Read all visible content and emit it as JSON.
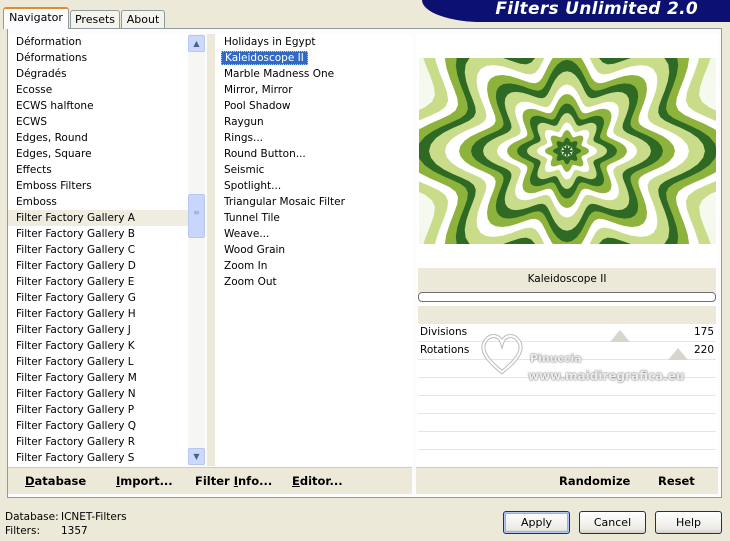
{
  "window": {
    "title": "Filters Unlimited 2.0"
  },
  "tabs": [
    {
      "label": "Navigator",
      "active": true
    },
    {
      "label": "Presets",
      "active": false
    },
    {
      "label": "About",
      "active": false
    }
  ],
  "categories": {
    "items": [
      "Déformation",
      "Déformations",
      "Dégradés",
      "Ecosse",
      "ECWS halftone",
      "ECWS",
      "Edges, Round",
      "Edges, Square",
      "Effects",
      "Emboss Filters",
      "Emboss",
      "Filter Factory Gallery A",
      "Filter Factory Gallery B",
      "Filter Factory Gallery C",
      "Filter Factory Gallery D",
      "Filter Factory Gallery E",
      "Filter Factory Gallery G",
      "Filter Factory Gallery H",
      "Filter Factory Gallery J",
      "Filter Factory Gallery K",
      "Filter Factory Gallery L",
      "Filter Factory Gallery M",
      "Filter Factory Gallery N",
      "Filter Factory Gallery P",
      "Filter Factory Gallery Q",
      "Filter Factory Gallery R",
      "Filter Factory Gallery S"
    ],
    "highlighted": "Filter Factory Gallery A"
  },
  "filters": {
    "items": [
      "Holidays in Egypt",
      "Kaleidoscope II",
      "Marble Madness One",
      "Mirror, Mirror",
      "Pool Shadow",
      "Raygun",
      "Rings...",
      "Round Button...",
      "Seismic",
      "Spotlight...",
      "Triangular Mosaic Filter",
      "Tunnel Tile",
      "Weave...",
      "Wood Grain",
      "Zoom In",
      "Zoom Out"
    ],
    "selected": "Kaleidoscope II"
  },
  "left_toolbar": {
    "database": {
      "label": "Database",
      "underline": "D",
      "rest": "atabase"
    },
    "import": {
      "label": "Import...",
      "underline": "I",
      "rest": "mport..."
    },
    "filter_info": {
      "label": "Filter Info...",
      "prefix": "Filter ",
      "underline": "I",
      "rest": "nfo..."
    },
    "editor": {
      "label": "Editor...",
      "underline": "E",
      "rest": "ditor..."
    }
  },
  "preview": {
    "filter_name": "Kaleidoscope II"
  },
  "parameters": [
    {
      "label": "Divisions",
      "value": "175"
    },
    {
      "label": "Rotations",
      "value": "220"
    }
  ],
  "right_toolbar": {
    "randomize": "Randomize",
    "reset": "Reset"
  },
  "status": {
    "database_label": "Database:",
    "database_value": "ICNET-Filters",
    "filters_label": "Filters:",
    "filters_value": "1357"
  },
  "dialog_buttons": {
    "apply": "Apply",
    "cancel": "Cancel",
    "help": "Help"
  },
  "watermark": {
    "line1": "Pinuccia",
    "line2": "www.maidiregrafica.eu"
  },
  "colors": {
    "selection": "#316ac5",
    "banner": "#0c1070",
    "kaleido_dark": "#2f6a25",
    "kaleido_mid": "#8db33c",
    "kaleido_light": "#c9dc8a"
  }
}
